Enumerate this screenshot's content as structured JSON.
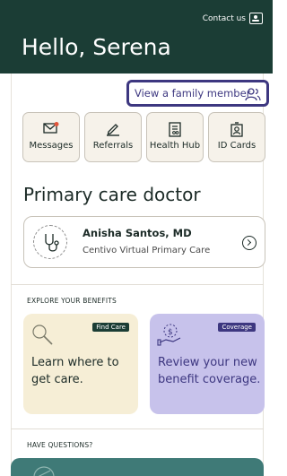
{
  "header": {
    "contact_label": "Contact us",
    "greeting": "Hello, Serena"
  },
  "family_button": {
    "label": "View a family member",
    "icon": "family-member-icon"
  },
  "quick_actions": [
    {
      "label": "Messages",
      "icon": "envelope-notification-icon"
    },
    {
      "label": "Referrals",
      "icon": "pencil-icon"
    },
    {
      "label": "Health Hub",
      "icon": "clipboard-icon"
    },
    {
      "label": "ID Cards",
      "icon": "id-card-icon"
    }
  ],
  "primary_care": {
    "title": "Primary care doctor",
    "doctor_name": "Anisha Santos, MD",
    "clinic": "Centivo Virtual Primary Care",
    "icon": "stethoscope-icon"
  },
  "benefits": {
    "section_label": "EXPLORE YOUR BENEFITS",
    "cards": [
      {
        "tag": "Find Care",
        "text": "Learn where to get care.",
        "icon": "magnifier-icon"
      },
      {
        "tag": "Coverage",
        "text": "Review your new benefit coverage.",
        "icon": "money-hand-icon"
      }
    ]
  },
  "questions": {
    "section_label": "HAVE QUESTIONS?"
  },
  "colors": {
    "header_bg": "#1b3d35",
    "accent_purple": "#3d3780",
    "find_card_bg": "#f6eed6",
    "coverage_card_bg": "#c7c2eb",
    "bottom_card_bg": "#3f7a77"
  }
}
